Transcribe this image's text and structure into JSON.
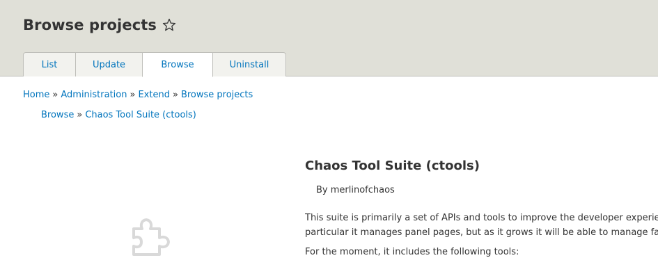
{
  "header": {
    "title": "Browse projects",
    "star_icon": "star-outline-icon"
  },
  "tabs": [
    {
      "label": "List",
      "active": false
    },
    {
      "label": "Update",
      "active": false
    },
    {
      "label": "Browse",
      "active": true
    },
    {
      "label": "Uninstall",
      "active": false
    }
  ],
  "breadcrumb": {
    "items": [
      "Home",
      "Administration",
      "Extend",
      "Browse projects"
    ],
    "separator": "»"
  },
  "subcrumb": {
    "items": [
      "Browse",
      "Chaos Tool Suite (ctools)"
    ],
    "separator": "»"
  },
  "project": {
    "icon": "puzzle-piece-icon",
    "title": "Chaos Tool Suite (ctools)",
    "author": "By merlinofchaos",
    "description_line1": "This suite is primarily a set of APIs and tools to improve the developer experie",
    "description_line2": "particular it manages panel pages, but as it grows it will be able to manage fa",
    "tools_intro": "For the moment, it includes the following tools:"
  },
  "colors": {
    "link": "#0074bd",
    "header_bg": "#e0e0d8",
    "text": "#333333"
  }
}
